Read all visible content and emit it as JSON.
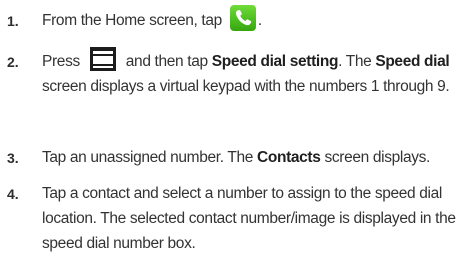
{
  "steps": [
    {
      "number": "1.",
      "before": "From the Home screen, tap ",
      "icon": "phone-icon",
      "after": "."
    },
    {
      "number": "2.",
      "t1": "Press ",
      "icon": "menu-key-icon",
      "t2": " and then tap ",
      "b1": "Speed dial setting",
      "t3": ". The ",
      "b2": "Speed dial",
      "t4": " screen displays a virtual keypad with the numbers 1 through 9."
    },
    {
      "number": "3.",
      "t1": "Tap an unassigned number. The ",
      "b1": "Contacts",
      "t2": " screen displays."
    },
    {
      "number": "4.",
      "text": "Tap a contact and select a number to assign to the speed dial location. The selected contact number/image is displayed in the speed dial number box."
    }
  ],
  "colors": {
    "phone_icon_bg": "#4cc320",
    "menu_icon_bg": "#1c1c1c",
    "text": "#333333"
  }
}
